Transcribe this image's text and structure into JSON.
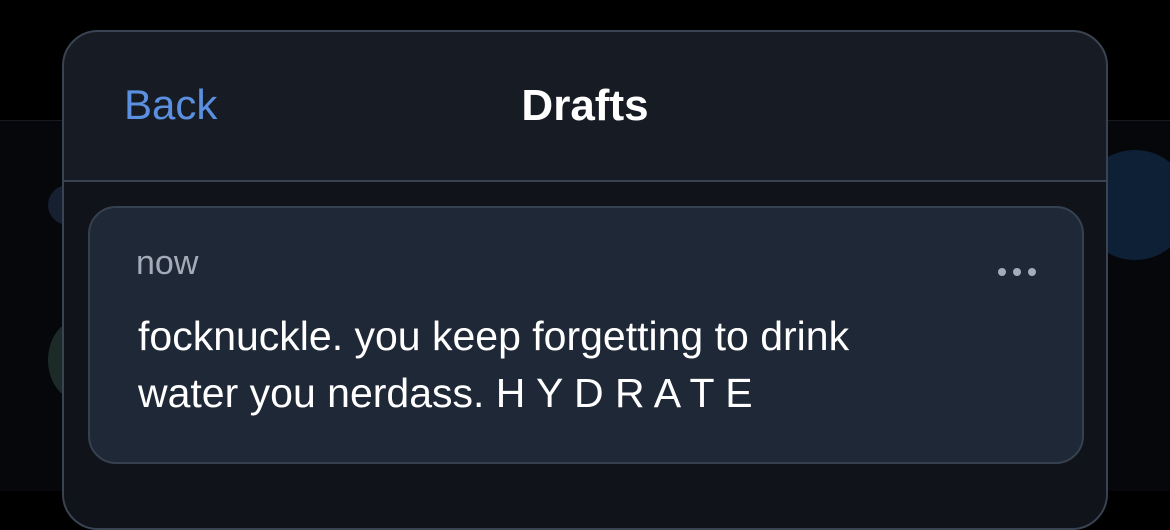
{
  "header": {
    "back_label": "Back",
    "title": "Drafts"
  },
  "drafts": [
    {
      "time": "now",
      "text": "focknuckle. you keep forgetting to drink\nwater you nerdass. H Y D R A T E",
      "menu_icon": "more-horizontal-icon"
    }
  ],
  "colors": {
    "accent": "#5b8fe0",
    "modal_bg": "#171c24",
    "card_bg": "#1f2837",
    "border": "#3a4352",
    "muted_text": "#a4acb8"
  }
}
